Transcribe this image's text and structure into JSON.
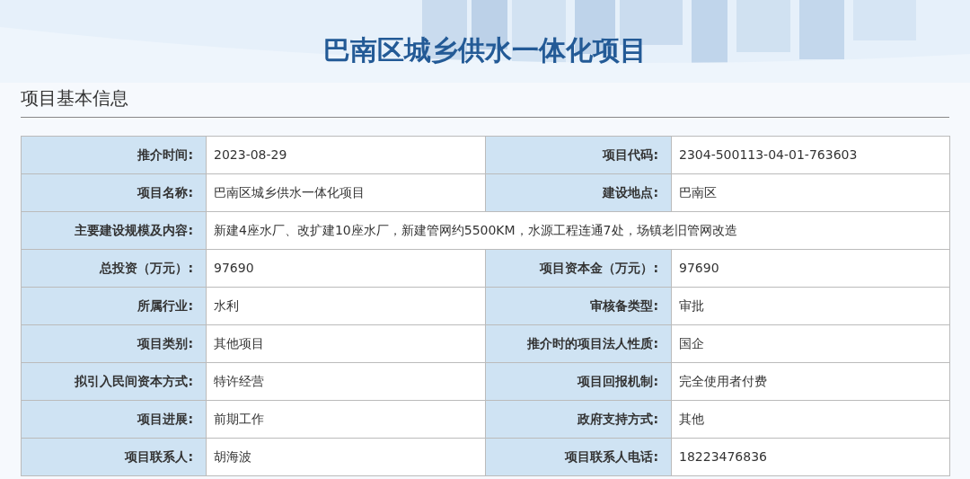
{
  "title": "巴南区城乡供水一体化项目",
  "section": "项目基本信息",
  "rows": [
    {
      "fields": [
        {
          "label": "推介时间:",
          "value": "2023-08-29"
        },
        {
          "label": "项目代码:",
          "value": "2304-500113-04-01-763603"
        }
      ]
    },
    {
      "fields": [
        {
          "label": "项目名称:",
          "value": "巴南区城乡供水一体化项目"
        },
        {
          "label": "建设地点:",
          "value": "巴南区"
        }
      ]
    },
    {
      "fields": [
        {
          "label": "主要建设规模及内容:",
          "value": "新建4座水厂、改扩建10座水厂，新建管网约5500KM，水源工程连通7处，场镇老旧管网改造"
        }
      ]
    },
    {
      "fields": [
        {
          "label": "总投资（万元）:",
          "value": "97690"
        },
        {
          "label": "项目资本金（万元）:",
          "value": "97690"
        }
      ]
    },
    {
      "fields": [
        {
          "label": "所属行业:",
          "value": "水利"
        },
        {
          "label": "审核备类型:",
          "value": "审批"
        }
      ]
    },
    {
      "fields": [
        {
          "label": "项目类别:",
          "value": "其他项目"
        },
        {
          "label": "推介时的项目法人性质:",
          "value": "国企"
        }
      ]
    },
    {
      "fields": [
        {
          "label": "拟引入民间资本方式:",
          "value": "特许经营"
        },
        {
          "label": "项目回报机制:",
          "value": "完全使用者付费"
        }
      ]
    },
    {
      "fields": [
        {
          "label": "项目进展:",
          "value": "前期工作"
        },
        {
          "label": "政府支持方式:",
          "value": "其他"
        }
      ]
    },
    {
      "fields": [
        {
          "label": "项目联系人:",
          "value": "胡海波"
        },
        {
          "label": "项目联系人电话:",
          "value": "18223476836"
        }
      ]
    }
  ]
}
